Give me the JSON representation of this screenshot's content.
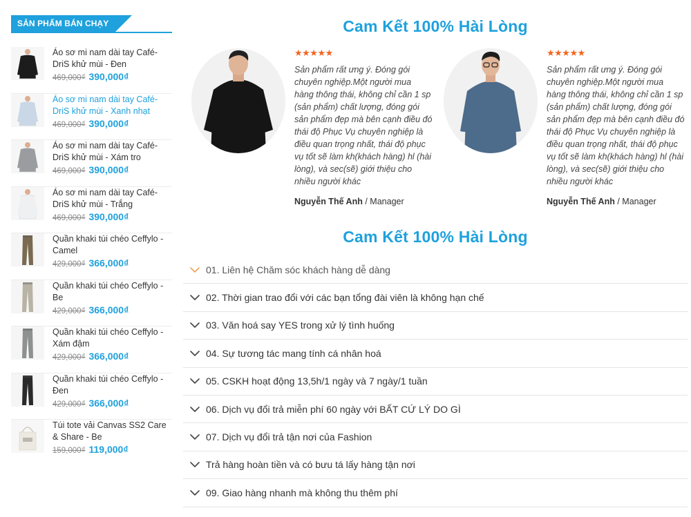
{
  "sidebar": {
    "title": "Sản phẩm bán chạy",
    "products": [
      {
        "name": "Áo sơ mi nam dài tay Café-DriS khử mùi - Đen",
        "old_price": "469,000₫",
        "new_price": "390,000₫",
        "thumb_color": "#1c1c1c"
      },
      {
        "name": "Áo sơ mi nam dài tay Café-DriS khử mùi - Xanh nhạt",
        "old_price": "469,000₫",
        "new_price": "390,000₫",
        "thumb_color": "#c9d7e6"
      },
      {
        "name": "Áo sơ mi nam dài tay Café-DriS khử mùi - Xám tro",
        "old_price": "469,000₫",
        "new_price": "390,000₫",
        "thumb_color": "#9a9ca0"
      },
      {
        "name": "Áo sơ mi nam dài tay Café-DriS khử mùi - Trắng",
        "old_price": "469,000₫",
        "new_price": "390,000₫",
        "thumb_color": "#eef0f2"
      },
      {
        "name": "Quần khaki túi chéo Ceffylo - Camel",
        "old_price": "429,000₫",
        "new_price": "366,000₫",
        "thumb_color": "#7a6a52"
      },
      {
        "name": "Quần khaki túi chéo Ceffylo - Be",
        "old_price": "429,000₫",
        "new_price": "366,000₫",
        "thumb_color": "#b9b3a6"
      },
      {
        "name": "Quần khaki túi chéo Ceffylo - Xám đậm",
        "old_price": "429,000₫",
        "new_price": "366,000₫",
        "thumb_color": "#8f9191"
      },
      {
        "name": "Quần khaki túi chéo Ceffylo - Đen",
        "old_price": "429,000₫",
        "new_price": "366,000₫",
        "thumb_color": "#2a2a2a"
      },
      {
        "name": "Túi tote vải Canvas SS2 Care & Share - Be",
        "old_price": "159,000₫",
        "new_price": "119,000₫",
        "thumb_color": "#ece9e2"
      }
    ]
  },
  "main": {
    "testimonials_title": "Cam Kết 100% Hài Lòng",
    "faq_title": "Cam Kết 100% Hài Lòng",
    "testimonials": [
      {
        "stars": "★★★★★",
        "quote": "Sản phẩm rất ưng ý. Đóng gói chuyên nghiệp.Một người mua hàng thông thái, không chỉ cần 1 sp (sản phẩm) chất lượng, đóng gói sản phẩm đẹp mà bên cạnh điều đó thái độ Phục Vụ chuyên nghiệp là điều quan trọng nhất, thái độ phục vụ tốt sẽ làm kh(khách hàng) hl (hài lòng), và sec(sẽ) giới thiệu cho nhiều người khác",
        "author": "Nguyễn Thế Anh",
        "role": "Manager",
        "shirt_color": "#151515"
      },
      {
        "stars": "★★★★★",
        "quote": "Sản phẩm rất ưng ý. Đóng gói chuyên nghiệp.Một người mua hàng thông thái, không chỉ cần 1 sp (sản phẩm) chất lượng, đóng gói sản phẩm đẹp mà bên cạnh điều đó thái độ Phục Vụ chuyên nghiệp là điều quan trọng nhất, thái độ phục vụ tốt sẽ làm kh(khách hàng) hl (hài lòng), và sec(sẽ) giới thiệu cho nhiều người khác",
        "author": "Nguyễn Thế Anh",
        "role": "Manager",
        "shirt_color": "#4d6b8a"
      }
    ],
    "faq": [
      "01. Liên hệ Chăm sóc khách hàng dễ dàng",
      "02. Thời gian trao đổi với các bạn tổng đài viên là không hạn chế",
      "03. Văn hoá say YES trong xử lý tình huống",
      "04. Sự tương tác mang tính cá nhân hoá",
      "05. CSKH hoạt động 13,5h/1 ngày và 7 ngày/1 tuần",
      "06. Dịch vụ đổi trả miễn phí 60 ngày với BẤT CỨ LÝ DO GÌ",
      "07. Dịch vụ đổi trả tận nơi của Fashion",
      "Trả hàng hoàn tiền và có bưu tá lấy hàng tận nơi",
      "09. Giao hàng nhanh mà không thu thêm phí"
    ]
  },
  "colors": {
    "accent": "#1ea1dd",
    "star": "#f26522",
    "chevron_open": "#e8a35a",
    "chevron": "#444444"
  }
}
